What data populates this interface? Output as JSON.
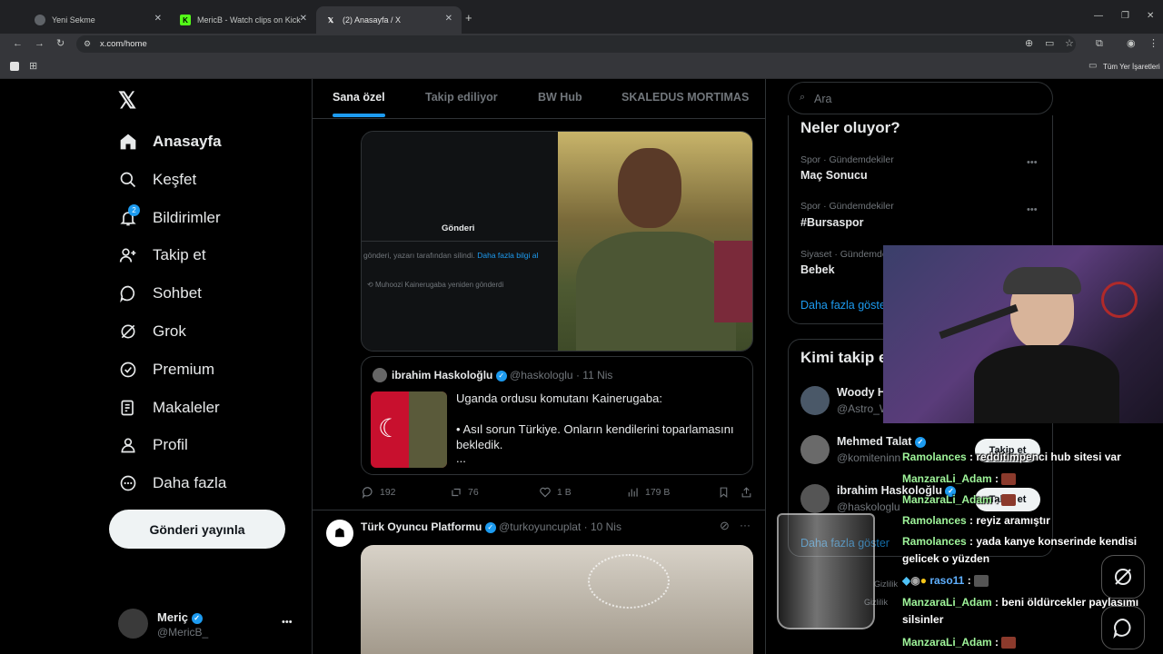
{
  "browser": {
    "tabs": [
      {
        "label": "Yeni Sekme",
        "active": false
      },
      {
        "label": "MericB - Watch clips on Kick",
        "active": false
      },
      {
        "label": "(2) Anasayfa / X",
        "active": true
      }
    ],
    "new_tab": "+",
    "url": "x.com/home",
    "bookmarks_label": "Tüm Yer İşaretleri"
  },
  "sidebar": {
    "items": [
      {
        "label": "Anasayfa",
        "icon": "home-icon"
      },
      {
        "label": "Keşfet",
        "icon": "search-icon"
      },
      {
        "label": "Bildirimler",
        "icon": "bell-icon",
        "badge": "2"
      },
      {
        "label": "Takip et",
        "icon": "person-add-icon"
      },
      {
        "label": "Sohbet",
        "icon": "chat-icon"
      },
      {
        "label": "Grok",
        "icon": "grok-icon"
      },
      {
        "label": "Premium",
        "icon": "verified-icon"
      },
      {
        "label": "Makaleler",
        "icon": "article-icon"
      },
      {
        "label": "Profil",
        "icon": "user-icon"
      },
      {
        "label": "Daha fazla",
        "icon": "more-icon"
      }
    ],
    "post_button": "Gönderi yayınla",
    "account": {
      "name": "Meriç",
      "handle": "@MericB_",
      "more": "•••"
    }
  },
  "feed": {
    "tabs": [
      "Sana özel",
      "Takip ediliyor",
      "BW Hub",
      "SKALEDUS MORTIMAS"
    ],
    "post1": {
      "embedded_title": "Gönderi",
      "embedded_deleted": "gönderi, yazarı tarafından silindi.",
      "embedded_link": "Daha fazla bilgi al",
      "embedded_repost": "Muhoozi Kainerugaba yeniden gönderdi",
      "quote": {
        "name": "ibrahim Haskoloğlu",
        "handle": "@haskologlu",
        "date": "· 11 Nis",
        "line1": "Uganda ordusu komutanı Kainerugaba:",
        "line2": "• Asıl sorun Türkiye. Onların kendilerini toparlamasını bekledik.",
        "line3": "..."
      },
      "replies": "192",
      "reposts": "76",
      "likes": "1 B",
      "views": "179 B"
    },
    "post2": {
      "name": "Türk Oyuncu Platformu",
      "handle": "@turkoyuncuplat",
      "date": "· 10 Nis"
    }
  },
  "right": {
    "search_placeholder": "Ara",
    "trends_title": "Neler oluyor?",
    "trends": [
      {
        "category": "Spor · Gündemdekiler",
        "title": "Maç Sonucu"
      },
      {
        "category": "Spor · Gündemdekiler",
        "title": "#Bursaspor"
      },
      {
        "category": "Siyaset · Gündemde",
        "title": "Bebek"
      }
    ],
    "trends_more": "Daha fazla göster",
    "follow_title": "Kimi takip et",
    "follows": [
      {
        "name": "Woody H",
        "handle": "@Astro_W"
      },
      {
        "name": "Mehmed Talat",
        "handle": "@komiteninn"
      },
      {
        "name": "ibrahim Haskoloğlu",
        "handle": "@haskologlu"
      }
    ],
    "follow_button": "Takip et",
    "follow_more": "Daha fazla göster",
    "footer1": "Gizlilik",
    "footer2": "Gizlilik"
  },
  "chat": [
    {
      "user": "Ramolances",
      "text": ": redditimpenci hub sitesi var"
    },
    {
      "user": "ManzaraLi_Adam",
      "text": ":"
    },
    {
      "user": "ManzaraLi_Adam",
      "text": ":"
    },
    {
      "user": "Ramolances",
      "text": ": reyiz aramıştır"
    },
    {
      "user": "Ramolances",
      "text": ": yada kanye konserinde kendisi gelicek o yüzden"
    },
    {
      "user": "raso11",
      "text": ":"
    },
    {
      "user": "ManzaraLi_Adam",
      "text": ": beni öldürcekler paylaşımı silsinler"
    },
    {
      "user": "ManzaraLi_Adam",
      "text": ":"
    }
  ]
}
